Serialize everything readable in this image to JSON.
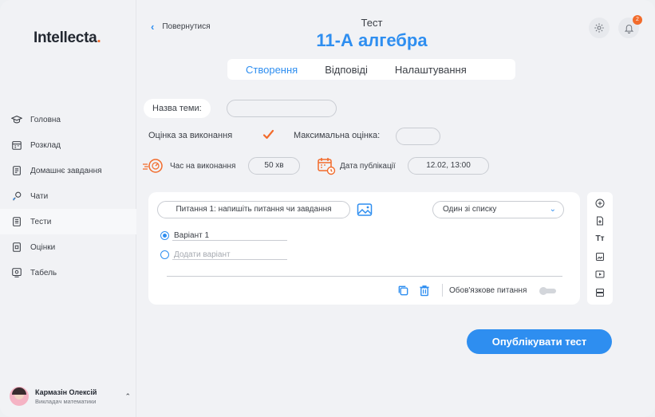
{
  "sidebar": {
    "logo": "Intellecta",
    "logo_dot": ".",
    "items": [
      {
        "label": "Головна",
        "icon": "graduation-cap-icon"
      },
      {
        "label": "Розклад",
        "icon": "calendar-icon"
      },
      {
        "label": "Домашнє завдання",
        "icon": "homework-icon"
      },
      {
        "label": "Чати",
        "icon": "chat-icon"
      },
      {
        "label": "Тести",
        "icon": "tests-icon",
        "active": true
      },
      {
        "label": "Оцінки",
        "icon": "grades-icon"
      },
      {
        "label": "Табель",
        "icon": "report-card-icon"
      }
    ],
    "user": {
      "name": "Кармазін Олексій",
      "role": "Викладач математики"
    }
  },
  "header": {
    "back_label": "Повернутися",
    "subtitle": "Тест",
    "title": "11-А алгебра",
    "notification_count": "2"
  },
  "tabs": [
    "Створення",
    "Відповіді",
    "Налаштування"
  ],
  "form": {
    "topic_label": "Назва теми:",
    "topic_value": "",
    "grading_label": "Оцінка за виконання",
    "max_grade_label": "Максимальна оцінка:",
    "max_grade_value": "",
    "time_label": "Час на виконання",
    "time_value": "50 хв",
    "publish_date_label": "Дата публікації",
    "publish_date_value": "12.02, 13:00"
  },
  "question": {
    "placeholder": "Питання 1: напишіть питання чи завдання",
    "type_select": "Один зі списку",
    "options": [
      {
        "label": "Варіант 1",
        "selected": true
      },
      {
        "label": "Додати варіант",
        "selected": false
      }
    ],
    "required_label": "Обов'язкове питання"
  },
  "tools": [
    "add-circle-icon",
    "import-icon",
    "text-icon",
    "image-icon",
    "video-icon",
    "section-icon"
  ],
  "publish_button": "Опублікувати тест",
  "colors": {
    "accent": "#2e8ef0",
    "brand_orange": "#f26b2b"
  }
}
